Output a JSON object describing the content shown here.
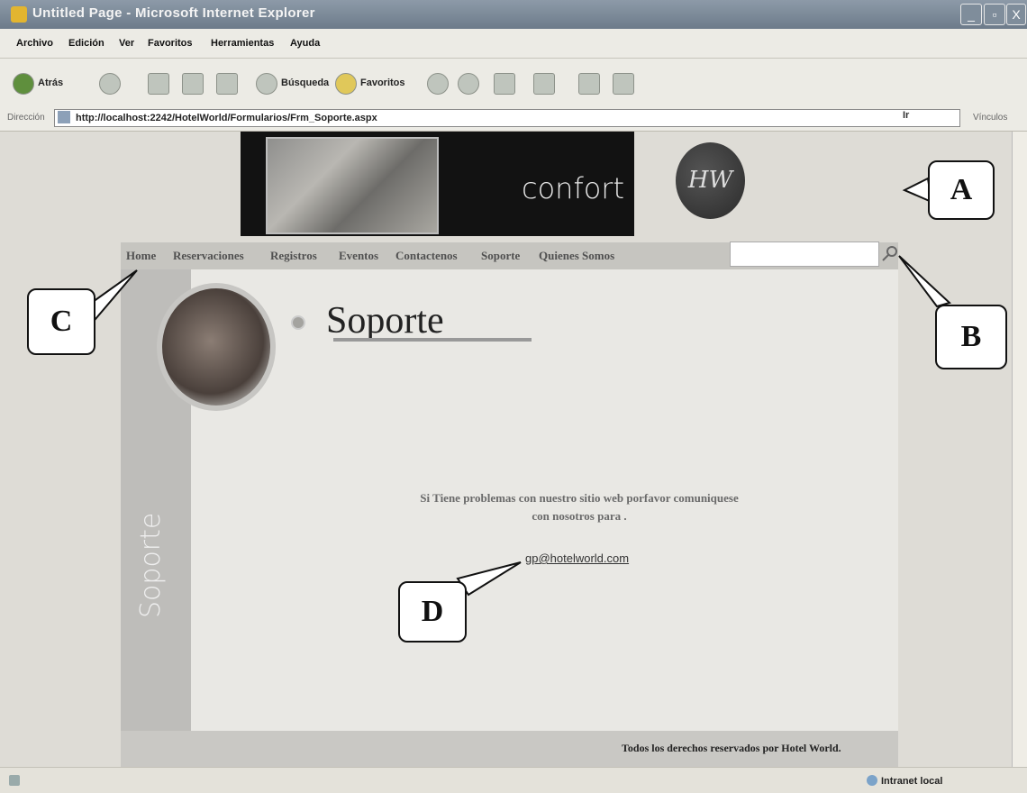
{
  "window": {
    "title": "Untitled Page - Microsoft Internet Explorer",
    "controls": [
      "_",
      "▫",
      "X"
    ]
  },
  "menu": [
    "Archivo",
    "Edición",
    "Ver",
    "Favoritos",
    "Herramientas",
    "Ayuda"
  ],
  "toolbar": {
    "back_label": "Atrás",
    "search_label": "Búsqueda",
    "favorites_label": "Favoritos"
  },
  "address": {
    "label": "Dirección",
    "url": "http://localhost:2242/HotelWorld/Formularios/Frm_Soporte.aspx",
    "go_label": "Ir",
    "links_label": "Vínculos"
  },
  "banner": {
    "text": "confort",
    "logo": "HW"
  },
  "nav": {
    "items": [
      "Home",
      "Reservaciones",
      "Registros",
      "Eventos",
      "Contactenos",
      "Soporte",
      "Quienes Somos"
    ],
    "search_value": ""
  },
  "page": {
    "title": "Soporte",
    "side_label": "Soporte",
    "message_line1": "Si Tiene problemas con nuestro sitio web porfavor comuniquese",
    "message_line2": "con nosotros para .",
    "email": "gp@hotelworld.com",
    "footer": "Todos los derechos reservados por Hotel World."
  },
  "callouts": {
    "a": "A",
    "b": "B",
    "c": "C",
    "d": "D"
  },
  "status": {
    "zone": "Intranet local"
  }
}
